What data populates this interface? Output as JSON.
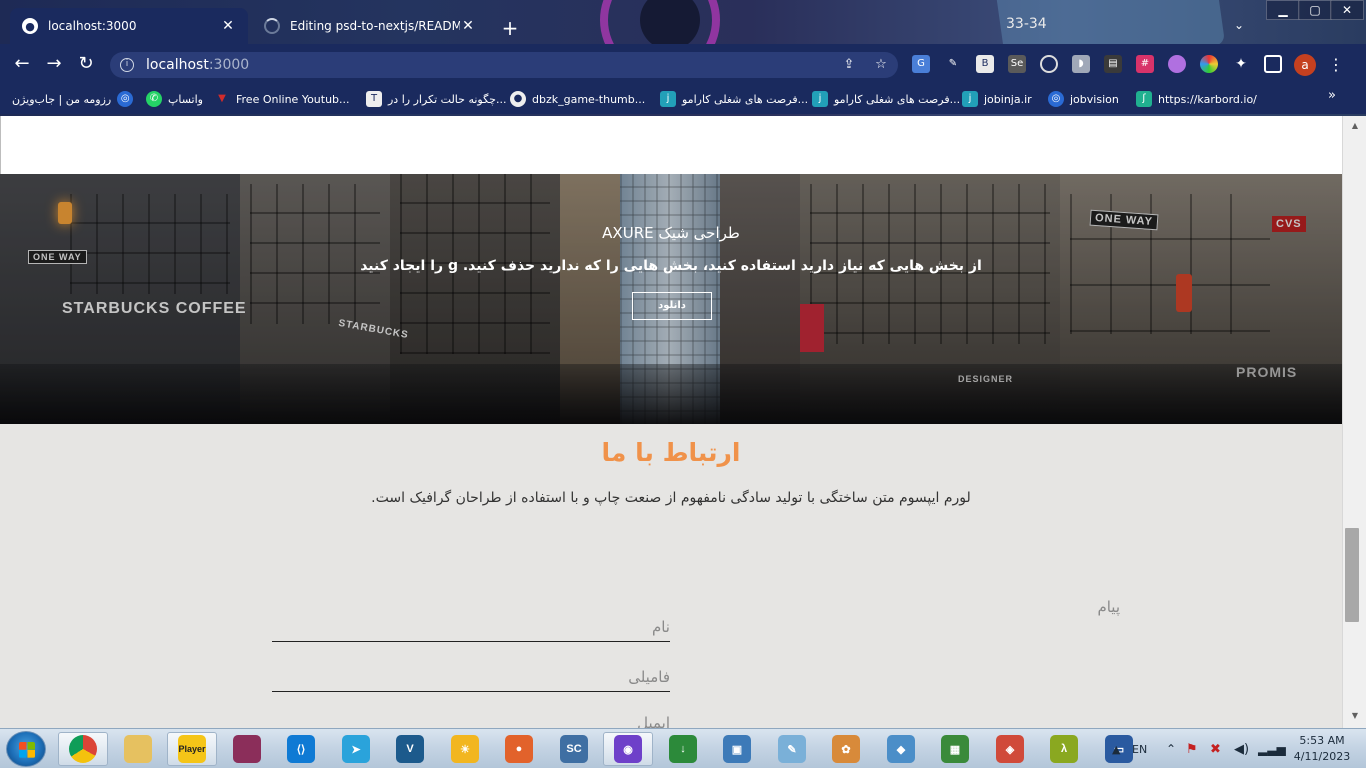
{
  "browser": {
    "tabs": [
      {
        "title": "localhost:3000",
        "active": true
      },
      {
        "title": "Editing psd-to-nextjs/README.m",
        "active": false
      }
    ],
    "deco_text": "33-34",
    "url_host": "localhost",
    "url_port": ":3000",
    "profile_initial": "a",
    "bookmarks": [
      {
        "label": "رزومه من | جاب‌ویژن",
        "icon_color": "#2a6ad4",
        "icon": "jobvision-icon"
      },
      {
        "label": "واتساپ",
        "icon_color": "#25d366",
        "icon": "whatsapp-icon"
      },
      {
        "label": "Free Online Youtub...",
        "icon_color": "#d12b2b",
        "icon": "youtube-icon"
      },
      {
        "label": "چگونه حالت تکرار را در...",
        "icon_color": "#eeeeee",
        "icon": "tech-icon"
      },
      {
        "label": "dbzk_game-thumb...",
        "icon_color": "#eeeeee",
        "icon": "globe-icon"
      },
      {
        "label": "فرصت های شغلی کارامو...",
        "icon_color": "#22a0b8",
        "icon": "jobinja-icon"
      },
      {
        "label": "فرصت های شغلی کارامو...",
        "icon_color": "#22a0b8",
        "icon": "jobinja-icon"
      },
      {
        "label": "jobinja.ir",
        "icon_color": "#22a0b8",
        "icon": "jobinja-icon"
      },
      {
        "label": "jobvision",
        "icon_color": "#2a6ad4",
        "icon": "jobvision-icon"
      },
      {
        "label": "https://karbord.io/",
        "icon_color": "#20b090",
        "icon": "karbord-icon"
      }
    ]
  },
  "hero": {
    "title_word": "طراحی شیک",
    "title_brand": "AXURE",
    "description": "از بخش هایی که نیاز دارید استفاده کنید، بخش هایی را که ندارید حذف کنید. g را ایجاد کنید",
    "button_label": "دانلود",
    "signs": {
      "starbucks": "STARBUCKS COFFEE",
      "starbucks2": "STARBUCKS",
      "one_way_1": "ONE WAY",
      "one_way_2": "ONE WAY",
      "cvs": "CVS",
      "designer": "DESIGNER",
      "promise": "PROMIS"
    }
  },
  "contact": {
    "title": "ارتباط با ما",
    "description": "لورم ایپسوم متن ساختگی با تولید سادگی نامفهوم از صنعت چاپ و با استفاده از طراحان گرافیک است.",
    "message_label": "پیام",
    "first_name_placeholder": "نام",
    "last_name_placeholder": "فامیلی",
    "partial_field": "ایمیل"
  },
  "taskbar": {
    "language": "EN",
    "time": "5:53 AM",
    "date": "4/11/2023",
    "apps": [
      {
        "name": "chrome",
        "running": true,
        "color": "#dd4b39",
        "glyph": ""
      },
      {
        "name": "file-explorer",
        "running": false,
        "color": "#e6c160",
        "glyph": ""
      },
      {
        "name": "kmplayer",
        "running": true,
        "color": "#f5c518",
        "glyph": "Player"
      },
      {
        "name": "winrar",
        "running": false,
        "color": "#8b2e5a",
        "glyph": ""
      },
      {
        "name": "vscode",
        "running": false,
        "color": "#0f7ad4",
        "glyph": "⟨⟩"
      },
      {
        "name": "telegram",
        "running": false,
        "color": "#2aa3db",
        "glyph": "➤"
      },
      {
        "name": "pycharm",
        "running": false,
        "color": "#1c5a8c",
        "glyph": "V"
      },
      {
        "name": "weather",
        "running": false,
        "color": "#f2b620",
        "glyph": "☀"
      },
      {
        "name": "camtasia",
        "running": false,
        "color": "#e2622b",
        "glyph": "●"
      },
      {
        "name": "screen-capture",
        "running": false,
        "color": "#3f6fa3",
        "glyph": "SC"
      },
      {
        "name": "github-desktop",
        "running": true,
        "color": "#6e40c9",
        "glyph": "◉"
      },
      {
        "name": "idm",
        "running": false,
        "color": "#2c8a3a",
        "glyph": "↓"
      },
      {
        "name": "virtualbox",
        "running": false,
        "color": "#3d7ab8",
        "glyph": "▣"
      },
      {
        "name": "notepad",
        "running": false,
        "color": "#7ab0d8",
        "glyph": "✎"
      },
      {
        "name": "paint",
        "running": false,
        "color": "#d88a3a",
        "glyph": "✿"
      },
      {
        "name": "3d-box",
        "running": false,
        "color": "#4b8ec8",
        "glyph": "◆"
      },
      {
        "name": "battery-tool",
        "running": false,
        "color": "#3a8a3a",
        "glyph": "▦"
      },
      {
        "name": "git-extension",
        "running": false,
        "color": "#d04a3a",
        "glyph": "◈"
      },
      {
        "name": "lambda-tool",
        "running": false,
        "color": "#8aa820",
        "glyph": "λ"
      },
      {
        "name": "remote-desktop",
        "running": false,
        "color": "#2a5aa0",
        "glyph": "▭"
      }
    ]
  }
}
